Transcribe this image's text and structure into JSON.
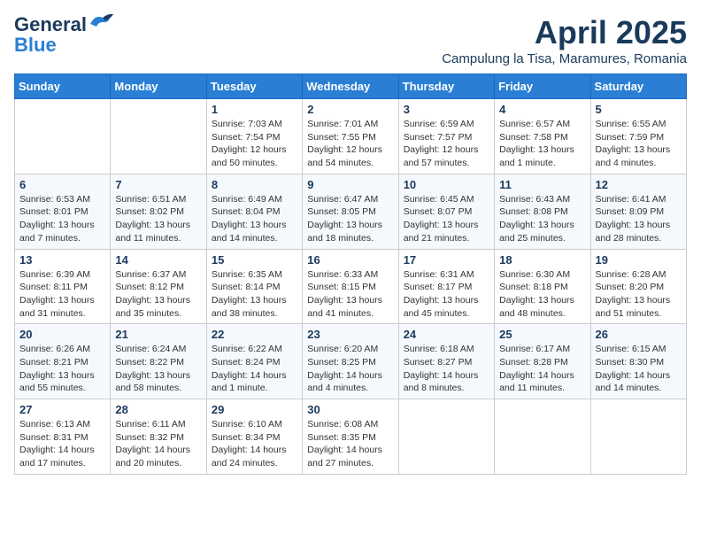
{
  "header": {
    "logo_general": "General",
    "logo_blue": "Blue",
    "month_title": "April 2025",
    "subtitle": "Campulung la Tisa, Maramures, Romania"
  },
  "days_of_week": [
    "Sunday",
    "Monday",
    "Tuesday",
    "Wednesday",
    "Thursday",
    "Friday",
    "Saturday"
  ],
  "weeks": [
    [
      {
        "day": "",
        "info": ""
      },
      {
        "day": "",
        "info": ""
      },
      {
        "day": "1",
        "info": "Sunrise: 7:03 AM\nSunset: 7:54 PM\nDaylight: 12 hours and 50 minutes."
      },
      {
        "day": "2",
        "info": "Sunrise: 7:01 AM\nSunset: 7:55 PM\nDaylight: 12 hours and 54 minutes."
      },
      {
        "day": "3",
        "info": "Sunrise: 6:59 AM\nSunset: 7:57 PM\nDaylight: 12 hours and 57 minutes."
      },
      {
        "day": "4",
        "info": "Sunrise: 6:57 AM\nSunset: 7:58 PM\nDaylight: 13 hours and 1 minute."
      },
      {
        "day": "5",
        "info": "Sunrise: 6:55 AM\nSunset: 7:59 PM\nDaylight: 13 hours and 4 minutes."
      }
    ],
    [
      {
        "day": "6",
        "info": "Sunrise: 6:53 AM\nSunset: 8:01 PM\nDaylight: 13 hours and 7 minutes."
      },
      {
        "day": "7",
        "info": "Sunrise: 6:51 AM\nSunset: 8:02 PM\nDaylight: 13 hours and 11 minutes."
      },
      {
        "day": "8",
        "info": "Sunrise: 6:49 AM\nSunset: 8:04 PM\nDaylight: 13 hours and 14 minutes."
      },
      {
        "day": "9",
        "info": "Sunrise: 6:47 AM\nSunset: 8:05 PM\nDaylight: 13 hours and 18 minutes."
      },
      {
        "day": "10",
        "info": "Sunrise: 6:45 AM\nSunset: 8:07 PM\nDaylight: 13 hours and 21 minutes."
      },
      {
        "day": "11",
        "info": "Sunrise: 6:43 AM\nSunset: 8:08 PM\nDaylight: 13 hours and 25 minutes."
      },
      {
        "day": "12",
        "info": "Sunrise: 6:41 AM\nSunset: 8:09 PM\nDaylight: 13 hours and 28 minutes."
      }
    ],
    [
      {
        "day": "13",
        "info": "Sunrise: 6:39 AM\nSunset: 8:11 PM\nDaylight: 13 hours and 31 minutes."
      },
      {
        "day": "14",
        "info": "Sunrise: 6:37 AM\nSunset: 8:12 PM\nDaylight: 13 hours and 35 minutes."
      },
      {
        "day": "15",
        "info": "Sunrise: 6:35 AM\nSunset: 8:14 PM\nDaylight: 13 hours and 38 minutes."
      },
      {
        "day": "16",
        "info": "Sunrise: 6:33 AM\nSunset: 8:15 PM\nDaylight: 13 hours and 41 minutes."
      },
      {
        "day": "17",
        "info": "Sunrise: 6:31 AM\nSunset: 8:17 PM\nDaylight: 13 hours and 45 minutes."
      },
      {
        "day": "18",
        "info": "Sunrise: 6:30 AM\nSunset: 8:18 PM\nDaylight: 13 hours and 48 minutes."
      },
      {
        "day": "19",
        "info": "Sunrise: 6:28 AM\nSunset: 8:20 PM\nDaylight: 13 hours and 51 minutes."
      }
    ],
    [
      {
        "day": "20",
        "info": "Sunrise: 6:26 AM\nSunset: 8:21 PM\nDaylight: 13 hours and 55 minutes."
      },
      {
        "day": "21",
        "info": "Sunrise: 6:24 AM\nSunset: 8:22 PM\nDaylight: 13 hours and 58 minutes."
      },
      {
        "day": "22",
        "info": "Sunrise: 6:22 AM\nSunset: 8:24 PM\nDaylight: 14 hours and 1 minute."
      },
      {
        "day": "23",
        "info": "Sunrise: 6:20 AM\nSunset: 8:25 PM\nDaylight: 14 hours and 4 minutes."
      },
      {
        "day": "24",
        "info": "Sunrise: 6:18 AM\nSunset: 8:27 PM\nDaylight: 14 hours and 8 minutes."
      },
      {
        "day": "25",
        "info": "Sunrise: 6:17 AM\nSunset: 8:28 PM\nDaylight: 14 hours and 11 minutes."
      },
      {
        "day": "26",
        "info": "Sunrise: 6:15 AM\nSunset: 8:30 PM\nDaylight: 14 hours and 14 minutes."
      }
    ],
    [
      {
        "day": "27",
        "info": "Sunrise: 6:13 AM\nSunset: 8:31 PM\nDaylight: 14 hours and 17 minutes."
      },
      {
        "day": "28",
        "info": "Sunrise: 6:11 AM\nSunset: 8:32 PM\nDaylight: 14 hours and 20 minutes."
      },
      {
        "day": "29",
        "info": "Sunrise: 6:10 AM\nSunset: 8:34 PM\nDaylight: 14 hours and 24 minutes."
      },
      {
        "day": "30",
        "info": "Sunrise: 6:08 AM\nSunset: 8:35 PM\nDaylight: 14 hours and 27 minutes."
      },
      {
        "day": "",
        "info": ""
      },
      {
        "day": "",
        "info": ""
      },
      {
        "day": "",
        "info": ""
      }
    ]
  ]
}
